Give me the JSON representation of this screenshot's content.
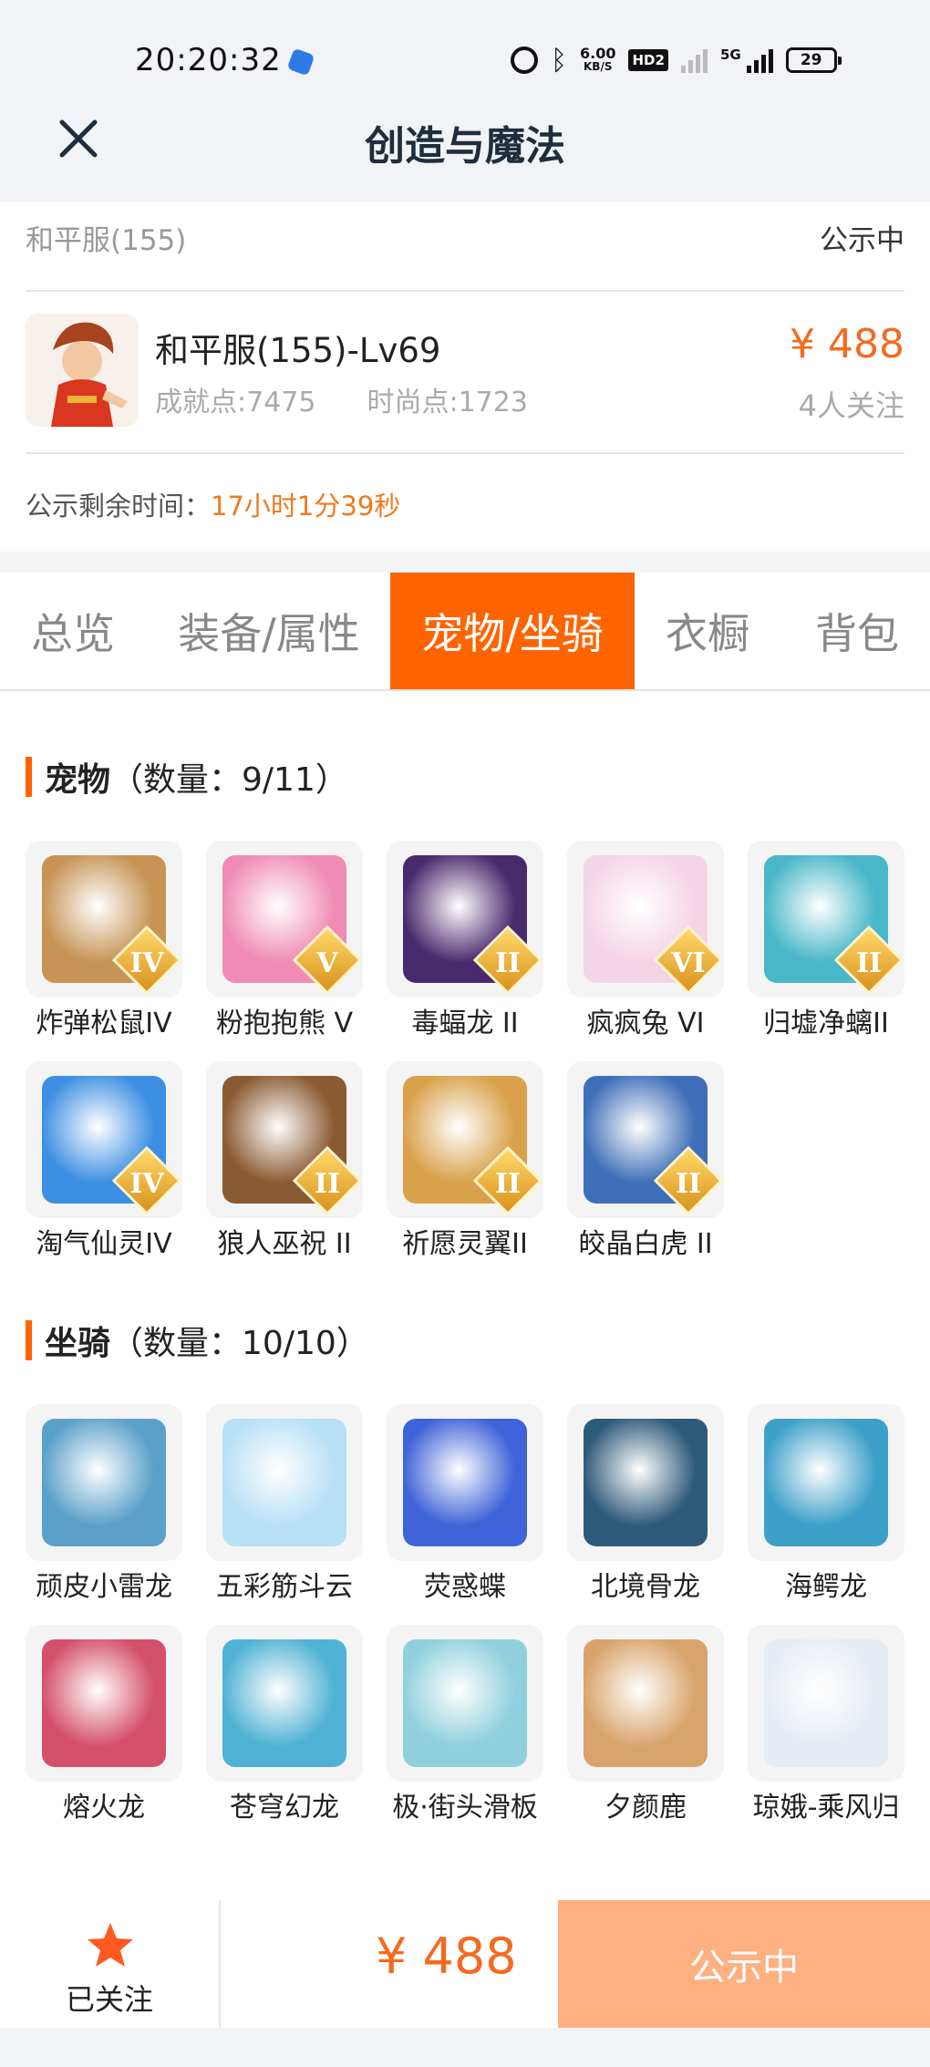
{
  "status_bar": {
    "time": "20:20:32",
    "net_speed_value": "6.00",
    "net_speed_unit": "KB/S",
    "hd_badge": "HD2",
    "network_type": "5G",
    "battery": "29"
  },
  "header": {
    "title": "创造与魔法"
  },
  "listing": {
    "server": "和平服(155)",
    "status": "公示中",
    "character_name": "和平服(155)-Lv69",
    "achievement_points": "成就点:7475",
    "fashion_points": "时尚点:1723",
    "price": "¥ 488",
    "followers": "4人关注",
    "timer_label": "公示剩余时间：",
    "timer_value": "17小时1分39秒"
  },
  "tabs": [
    {
      "label": "总览",
      "active": false
    },
    {
      "label": "装备/属性",
      "active": false
    },
    {
      "label": "宠物/坐骑",
      "active": true
    },
    {
      "label": "衣橱",
      "active": false
    },
    {
      "label": "背包",
      "active": false
    }
  ],
  "pets": {
    "title": "宠物",
    "count": "（数量：9/11）",
    "items": [
      {
        "name": "炸弹松鼠IV",
        "rank": "IV",
        "color": "#c79455"
      },
      {
        "name": "粉抱抱熊 V",
        "rank": "V",
        "color": "#f08cb4"
      },
      {
        "name": "毒蝠龙 II",
        "rank": "II",
        "color": "#4a2a6e"
      },
      {
        "name": "疯疯兔 VI",
        "rank": "VI",
        "color": "#f5d4e6"
      },
      {
        "name": "归墟净螭II",
        "rank": "II",
        "color": "#48b7c8"
      },
      {
        "name": "淘气仙灵IV",
        "rank": "IV",
        "color": "#3d8fe3"
      },
      {
        "name": "狼人巫祝 II",
        "rank": "II",
        "color": "#8a5a32"
      },
      {
        "name": "祈愿灵翼II",
        "rank": "II",
        "color": "#d9a14a"
      },
      {
        "name": "皎晶白虎 II",
        "rank": "II",
        "color": "#3f6fb8"
      }
    ]
  },
  "mounts": {
    "title": "坐骑",
    "count": "（数量：10/10）",
    "items": [
      {
        "name": "顽皮小雷龙",
        "color": "#5aa0c9"
      },
      {
        "name": "五彩筋斗云",
        "color": "#b8e0f6"
      },
      {
        "name": "荧惑蝶",
        "color": "#3f63d8"
      },
      {
        "name": "北境骨龙",
        "color": "#2e5a7a"
      },
      {
        "name": "海鳄龙",
        "color": "#3da0c9"
      },
      {
        "name": "熔火龙",
        "color": "#d4506a"
      },
      {
        "name": "苍穹幻龙",
        "color": "#4fb2d4"
      },
      {
        "name": "极·街头滑板",
        "color": "#8fd0dc"
      },
      {
        "name": "夕颜鹿",
        "color": "#d9a46c"
      },
      {
        "name": "琼娥-乘风归",
        "color": "#e6ecf4"
      }
    ]
  },
  "bottom": {
    "follow_label": "已关注",
    "price": "¥ 488",
    "status_label": "公示中"
  },
  "colors": {
    "accent": "#ff6400",
    "price": "#f56a1e",
    "status_button": "#ffb081"
  }
}
